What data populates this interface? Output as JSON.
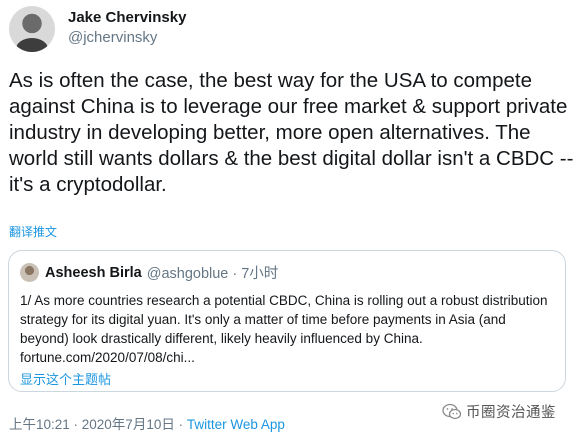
{
  "author": {
    "display_name": "Jake Chervinsky",
    "handle": "@jchervinsky"
  },
  "tweet": {
    "text": "As is often the case, the best way for the USA to compete against China is to leverage our free market & support private industry in developing better, more open alternatives. The world still wants dollars & the best digital dollar isn't a CBDC -- it's a cryptodollar.",
    "translate_label": "翻译推文"
  },
  "quoted_tweet": {
    "display_name": "Asheesh Birla",
    "handle_time": "@ashgoblue · 7小时",
    "text": "1/ As more countries research a potential CBDC, China is rolling out a robust distribution strategy for its digital yuan. It's only a matter of time before payments in Asia (and beyond) look drastically different, likely heavily influenced by China. fortune.com/2020/07/08/chi...",
    "show_thread": "显示这个主题帖"
  },
  "meta": {
    "timestamp": "上午10:21 · 2020年7月10日 · ",
    "source": "Twitter Web App"
  },
  "watermark": {
    "text": "币圈资治通鉴",
    "icon": "wechat-icon"
  }
}
